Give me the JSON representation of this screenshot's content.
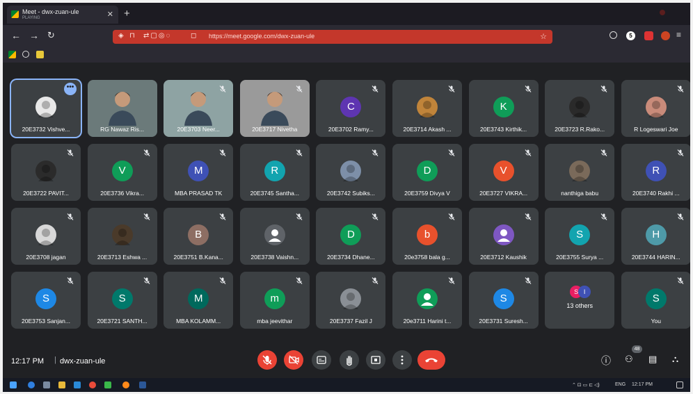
{
  "browser": {
    "tab_title": "Meet - dwx-zuan-ule",
    "tab_status": "PLAYING",
    "url": "https://meet.google.com/dwx-zuan-ule",
    "profile_initial": "5"
  },
  "participants": [
    {
      "name": "20E3732 Vishve...",
      "avatar_kind": "image",
      "color": "#e8e8e8",
      "active": true,
      "muted": false
    },
    {
      "name": "RG Nawaz Ris...",
      "avatar_kind": "video",
      "color": "#6b7a7a",
      "muted": false
    },
    {
      "name": "20E3703 Neer...",
      "avatar_kind": "video",
      "color": "#8ea3a3",
      "muted": true
    },
    {
      "name": "20E3717 Nivetha",
      "avatar_kind": "video",
      "color": "#9a9a9a",
      "muted": true
    },
    {
      "name": "20E3702 Ramy...",
      "avatar_kind": "letter",
      "initial": "C",
      "color": "#5e35b1",
      "muted": true
    },
    {
      "name": "20E3714 Akash ...",
      "avatar_kind": "image",
      "color": "#c0843a",
      "muted": true
    },
    {
      "name": "20E3743 Kirthik...",
      "avatar_kind": "letter",
      "initial": "K",
      "color": "#0f9d58",
      "muted": true
    },
    {
      "name": "20E3723 R.Rako...",
      "avatar_kind": "image",
      "color": "#2a2a2a",
      "muted": true
    },
    {
      "name": "R Logeswari Joe",
      "avatar_kind": "image",
      "color": "#c98b7a",
      "muted": true
    },
    {
      "name": "20E3722 PAVIT...",
      "avatar_kind": "image",
      "color": "#2b2b2b",
      "muted": true
    },
    {
      "name": "20E3736 Vikra...",
      "avatar_kind": "letter",
      "initial": "V",
      "color": "#0f9d58",
      "muted": true
    },
    {
      "name": "MBA PRASAD TK",
      "avatar_kind": "letter",
      "initial": "M",
      "color": "#3f51b5",
      "muted": true
    },
    {
      "name": "20E3745 Santha...",
      "avatar_kind": "letter",
      "initial": "R",
      "color": "#12a4af",
      "muted": true
    },
    {
      "name": "20E3742 Subiks...",
      "avatar_kind": "image",
      "color": "#7d8fa8",
      "muted": true
    },
    {
      "name": "20E3759 Divya V",
      "avatar_kind": "letter",
      "initial": "D",
      "color": "#0f9d58",
      "muted": true
    },
    {
      "name": "20E3727 VIKRA...",
      "avatar_kind": "letter",
      "initial": "V",
      "color": "#e8512c",
      "muted": true
    },
    {
      "name": "nanthiga babu",
      "avatar_kind": "image",
      "color": "#7a6a5a",
      "muted": true
    },
    {
      "name": "20E3740 Rakhi ...",
      "avatar_kind": "letter",
      "initial": "R",
      "color": "#3f51b5",
      "muted": true
    },
    {
      "name": "20E3708 jagan",
      "avatar_kind": "image",
      "color": "#d8d8d8",
      "muted": true
    },
    {
      "name": "20E3713 Eshwa ...",
      "avatar_kind": "image",
      "color": "#4a3a2a",
      "muted": true
    },
    {
      "name": "20E3751 B.Kana...",
      "avatar_kind": "letter",
      "initial": "B",
      "color": "#8d6e63",
      "muted": true
    },
    {
      "name": "20E3738 Vaishn...",
      "avatar_kind": "person",
      "color": "#5f6368",
      "muted": true
    },
    {
      "name": "20E3734 Dhane...",
      "avatar_kind": "letter",
      "initial": "D",
      "color": "#0f9d58",
      "muted": true
    },
    {
      "name": "20e3758 bala g...",
      "avatar_kind": "letter",
      "initial": "b",
      "color": "#e8512c",
      "muted": true
    },
    {
      "name": "20E3712 Kaushik",
      "avatar_kind": "person",
      "color": "#7e57c2",
      "muted": true
    },
    {
      "name": "20E3755 Surya ...",
      "avatar_kind": "letter",
      "initial": "S",
      "color": "#12a4af",
      "muted": true
    },
    {
      "name": "20E3744 HARIN...",
      "avatar_kind": "letter",
      "initial": "H",
      "color": "#4e9aa8",
      "muted": true
    },
    {
      "name": "20E3753 Sanjan...",
      "avatar_kind": "letter",
      "initial": "S",
      "color": "#1e88e5",
      "muted": true
    },
    {
      "name": "20E3721 SANTH...",
      "avatar_kind": "letter",
      "initial": "S",
      "color": "#00796b",
      "muted": true
    },
    {
      "name": "MBA KOLAMM...",
      "avatar_kind": "letter",
      "initial": "M",
      "color": "#00695c",
      "muted": true
    },
    {
      "name": "mba jeevithar",
      "avatar_kind": "letter",
      "initial": "m",
      "color": "#0f9d58",
      "muted": true
    },
    {
      "name": "20E3737 Fazil J",
      "avatar_kind": "image",
      "color": "#8a8f95",
      "muted": true
    },
    {
      "name": "20e3711 Harini t...",
      "avatar_kind": "person",
      "color": "#0f9d58",
      "muted": true
    },
    {
      "name": "20E3731 Suresh...",
      "avatar_kind": "letter",
      "initial": "S",
      "color": "#1e88e5",
      "muted": true
    },
    {
      "name": "13 others",
      "avatar_kind": "others",
      "color": "#3c4043",
      "muted": false
    },
    {
      "name": "You",
      "avatar_kind": "letter",
      "initial": "S",
      "color": "#00796b",
      "muted": true
    }
  ],
  "others_avatars": [
    {
      "initial": "S",
      "color": "#e91e63"
    },
    {
      "initial": "I",
      "color": "#3f51b5"
    }
  ],
  "meeting": {
    "time": "12:17 PM",
    "separator": "|",
    "code": "dwx-zuan-ule",
    "participant_count": "48"
  },
  "controls": [
    "mic-off",
    "camera-off",
    "captions",
    "raise-hand",
    "present",
    "more",
    "leave-call"
  ],
  "taskbar": {
    "lang": "ENG",
    "clock": "12:17 PM"
  }
}
